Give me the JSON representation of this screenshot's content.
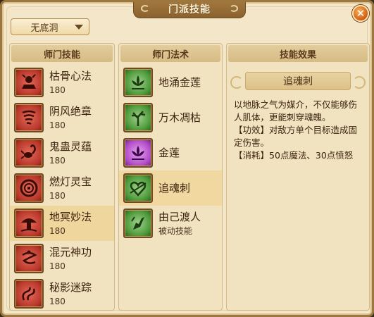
{
  "window": {
    "title": "门派技能"
  },
  "dropdown": {
    "selected": "无底洞"
  },
  "panels": {
    "left_header": "师门技能",
    "mid_header": "师门法术",
    "right_header": "技能效果"
  },
  "skills": [
    {
      "name": "枯骨心法",
      "level": "180",
      "icon": "skull-altar-icon"
    },
    {
      "name": "阴风绝章",
      "level": "180",
      "icon": "whirlwind-icon"
    },
    {
      "name": "鬼蛊灵蕴",
      "level": "180",
      "icon": "scorpion-icon"
    },
    {
      "name": "燃灯灵宝",
      "level": "180",
      "icon": "coin-lamp-icon"
    },
    {
      "name": "地冥妙法",
      "level": "180",
      "icon": "mushroom-icon"
    },
    {
      "name": "混元神功",
      "level": "180",
      "icon": "spiral-figure-icon"
    },
    {
      "name": "秘影迷踪",
      "level": "180",
      "icon": "shadow-swirl-icon"
    }
  ],
  "spells": [
    {
      "name": "地涌金莲",
      "sub": "",
      "icon": "lotus-icon"
    },
    {
      "name": "万木凋枯",
      "sub": "",
      "icon": "withered-tree-icon"
    },
    {
      "name": "金莲",
      "sub": "",
      "icon": "purple-lotus-icon"
    },
    {
      "name": "追魂刺",
      "sub": "",
      "icon": "heart-thorn-icon"
    },
    {
      "name": "由己渡人",
      "sub": "被动技能",
      "icon": "hand-blade-icon"
    }
  ],
  "detail": {
    "title": "追魂刺",
    "line1": "以地脉之气为媒介，不仅能够伤人肌体，更能刺穿魂魄。",
    "line2": "【功效】对敌方单个目标造成固定伤害。",
    "line3": "【消耗】50点魔法、30点愤怒"
  }
}
